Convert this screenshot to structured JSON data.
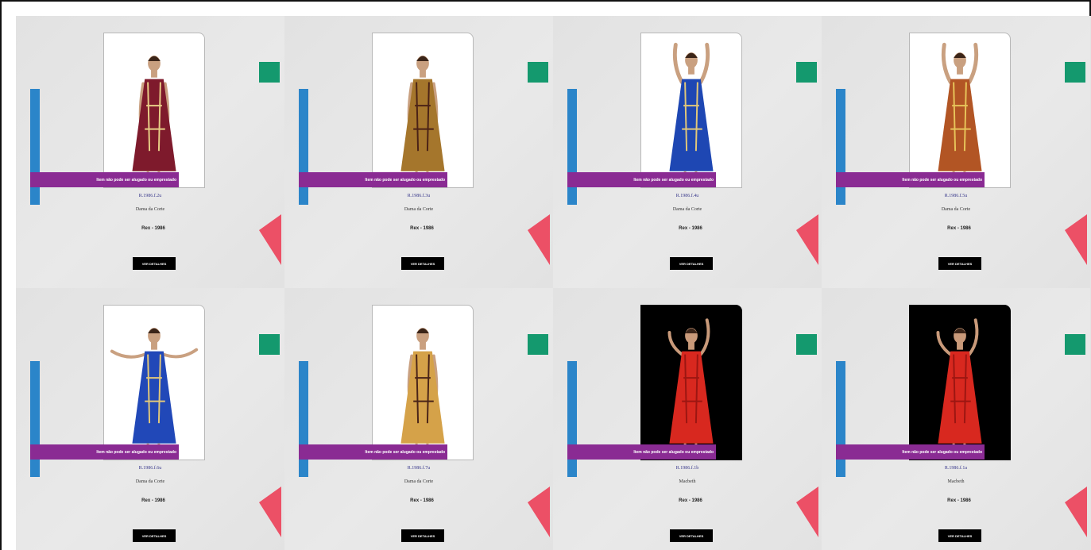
{
  "cards": [
    {
      "code": "R.1986.f.2u",
      "title": "Dama da Corte",
      "info": "Rex - 1986",
      "status": "Item não pode ser alugado ou emprestado",
      "button": "VER DETALHES",
      "bg": "light",
      "dress": "#7e1a2c",
      "accent": "#e8cf87",
      "pose": "down"
    },
    {
      "code": "R.1986.f.3u",
      "title": "Dama da Corte",
      "info": "Rex - 1986",
      "status": "Item não pode ser alugado ou emprestado",
      "button": "VER DETALHES",
      "bg": "light",
      "dress": "#a5762c",
      "accent": "#4b2216",
      "pose": "down"
    },
    {
      "code": "R.1986.f.4u",
      "title": "Dama da Corte",
      "info": "Rex - 1986",
      "status": "Item não pode ser alugado ou emprestado",
      "button": "VER DETALHES",
      "bg": "light",
      "dress": "#1e47b3",
      "accent": "#e2c879",
      "pose": "up"
    },
    {
      "code": "R.1986.f.5u",
      "title": "Dama da Corte",
      "info": "Rex - 1986",
      "status": "Item não pode ser alugado ou emprestado",
      "button": "VER DETALHES",
      "bg": "light",
      "dress": "#b25524",
      "accent": "#e7c45a",
      "pose": "up"
    },
    {
      "code": "R.1986.f.6u",
      "title": "Dama da Corte",
      "info": "Rex - 1986",
      "status": "Item não pode ser alugado ou emprestado",
      "button": "VER DETALHES",
      "bg": "light",
      "dress": "#2148b8",
      "accent": "#e2c879",
      "pose": "out"
    },
    {
      "code": "R.1986.f.7u",
      "title": "Dama da Corte",
      "info": "Rex - 1986",
      "status": "Item não pode ser alugado ou emprestado",
      "button": "VER DETALHES",
      "bg": "light",
      "dress": "#d5a249",
      "accent": "#4a2418",
      "pose": "down"
    },
    {
      "code": "R.1986.f.1b",
      "title": "Macbeth",
      "info": "Rex - 1986",
      "status": "Item não pode ser alugado ou emprestado",
      "button": "VER DETALHES",
      "bg": "dark",
      "dress": "#d8281f",
      "accent": "#9c1612",
      "pose": "dance"
    },
    {
      "code": "R.1986.f.1a",
      "title": "Macbeth",
      "info": "Rex - 1986",
      "status": "Item não pode ser alugado ou emprestado",
      "button": "VER DETALHES",
      "bg": "dark",
      "dress": "#d8281f",
      "accent": "#9c1612",
      "pose": "dance"
    }
  ],
  "colors": {
    "blue_bar": "#2b85c9",
    "green_square": "#14996e",
    "red_shape": "#ec5066",
    "banner": "#8a2b93"
  }
}
